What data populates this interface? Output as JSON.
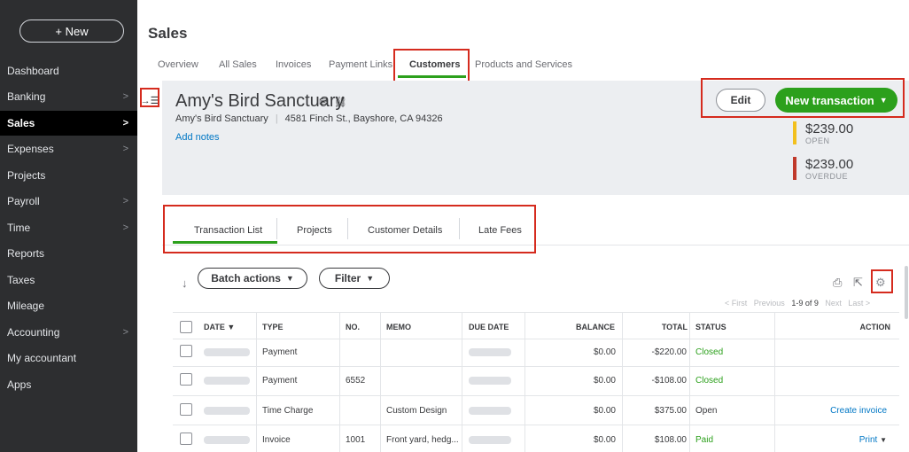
{
  "sidebar": {
    "new_button": "+ New",
    "items": [
      {
        "label": "Dashboard",
        "chevron": false
      },
      {
        "label": "Banking",
        "chevron": true
      },
      {
        "label": "Sales",
        "chevron": true,
        "active": true
      },
      {
        "label": "Expenses",
        "chevron": true
      },
      {
        "label": "Projects",
        "chevron": false
      },
      {
        "label": "Payroll",
        "chevron": true
      },
      {
        "label": "Time",
        "chevron": true
      },
      {
        "label": "Reports",
        "chevron": false
      },
      {
        "label": "Taxes",
        "chevron": false
      },
      {
        "label": "Mileage",
        "chevron": false
      },
      {
        "label": "Accounting",
        "chevron": true
      },
      {
        "label": "My accountant",
        "chevron": false
      },
      {
        "label": "Apps",
        "chevron": false
      }
    ],
    "chevron_glyph": ">"
  },
  "header": {
    "title": "Sales",
    "tabs": [
      "Overview",
      "All Sales",
      "Invoices",
      "Payment Links",
      "Customers",
      "Products and Services"
    ],
    "selected_tab": "Customers"
  },
  "customer": {
    "name": "Amy's Bird Sanctuary",
    "company": "Amy's Bird Sanctuary",
    "address": "4581 Finch St., Bayshore, CA 94326",
    "add_notes": "Add notes",
    "edit_label": "Edit",
    "new_transaction_label": "New transaction",
    "open_amount": "$239.00",
    "open_label": "OPEN",
    "overdue_amount": "$239.00",
    "overdue_label": "OVERDUE"
  },
  "subtabs": [
    "Transaction List",
    "Projects",
    "Customer Details",
    "Late Fees"
  ],
  "toolbar": {
    "batch_actions": "Batch actions",
    "filter": "Filter",
    "caret": "▼"
  },
  "pager": {
    "first": "< First",
    "previous": "Previous",
    "range": "1-9 of 9",
    "next": "Next",
    "last": "Last >"
  },
  "table": {
    "headers": {
      "date": "DATE ▼",
      "type": "TYPE",
      "no": "NO.",
      "memo": "MEMO",
      "due_date": "DUE DATE",
      "balance": "BALANCE",
      "total": "TOTAL",
      "status": "STATUS",
      "action": "ACTION"
    },
    "rows": [
      {
        "type": "Payment",
        "no": "",
        "memo": "",
        "balance": "$0.00",
        "total": "-$220.00",
        "status": "Closed",
        "action": ""
      },
      {
        "type": "Payment",
        "no": "6552",
        "memo": "",
        "balance": "$0.00",
        "total": "-$108.00",
        "status": "Closed",
        "action": ""
      },
      {
        "type": "Time Charge",
        "no": "",
        "memo": "Custom Design",
        "balance": "$0.00",
        "total": "$375.00",
        "status": "Open",
        "action": "Create invoice"
      },
      {
        "type": "Invoice",
        "no": "1001",
        "memo": "Front yard, hedg...",
        "balance": "$0.00",
        "total": "$108.00",
        "status": "Paid",
        "action": "Print"
      }
    ]
  },
  "colors": {
    "accent_green": "#2ca01c",
    "highlight_red": "#d52b1e",
    "open_bar": "#f2c01e",
    "overdue_bar": "#c0392b",
    "link_blue": "#0077c5"
  }
}
